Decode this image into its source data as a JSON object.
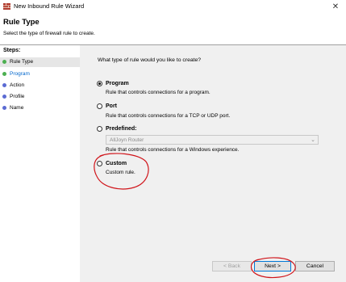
{
  "window": {
    "title": "New Inbound Rule Wizard",
    "close_glyph": "✕",
    "icon": "firewall-app-icon"
  },
  "header": {
    "title": "Rule Type",
    "subtitle": "Select the type of firewall rule to create."
  },
  "sidebar": {
    "title": "Steps:",
    "steps": [
      {
        "label": "Rule Type",
        "color": "#4caf50",
        "active": true
      },
      {
        "label": "Program",
        "color": "#4caf50",
        "active": false,
        "link": true
      },
      {
        "label": "Action",
        "color": "#5b6bd3",
        "active": false
      },
      {
        "label": "Profile",
        "color": "#5b6bd3",
        "active": false
      },
      {
        "label": "Name",
        "color": "#5b6bd3",
        "active": false
      }
    ]
  },
  "main": {
    "question": "What type of rule would you like to create?",
    "options": [
      {
        "label": "Program",
        "description": "Rule that controls connections for a program.",
        "selected": true
      },
      {
        "label": "Port",
        "description": "Rule that controls connections for a TCP or UDP port.",
        "selected": false
      },
      {
        "label": "Predefined:",
        "description": "Rule that controls connections for a Windows experience.",
        "selected": false
      },
      {
        "label": "Custom",
        "description": "Custom rule.",
        "selected": false
      }
    ],
    "predefined_dropdown": {
      "value": "AllJoyn Router",
      "arrow_glyph": "⌄"
    }
  },
  "buttons": {
    "back": "< Back",
    "next": "Next >",
    "cancel": "Cancel"
  },
  "colors": {
    "link_blue": "#0066cc",
    "annotation_red": "#d0141a",
    "main_bg": "#f0f0f0"
  }
}
